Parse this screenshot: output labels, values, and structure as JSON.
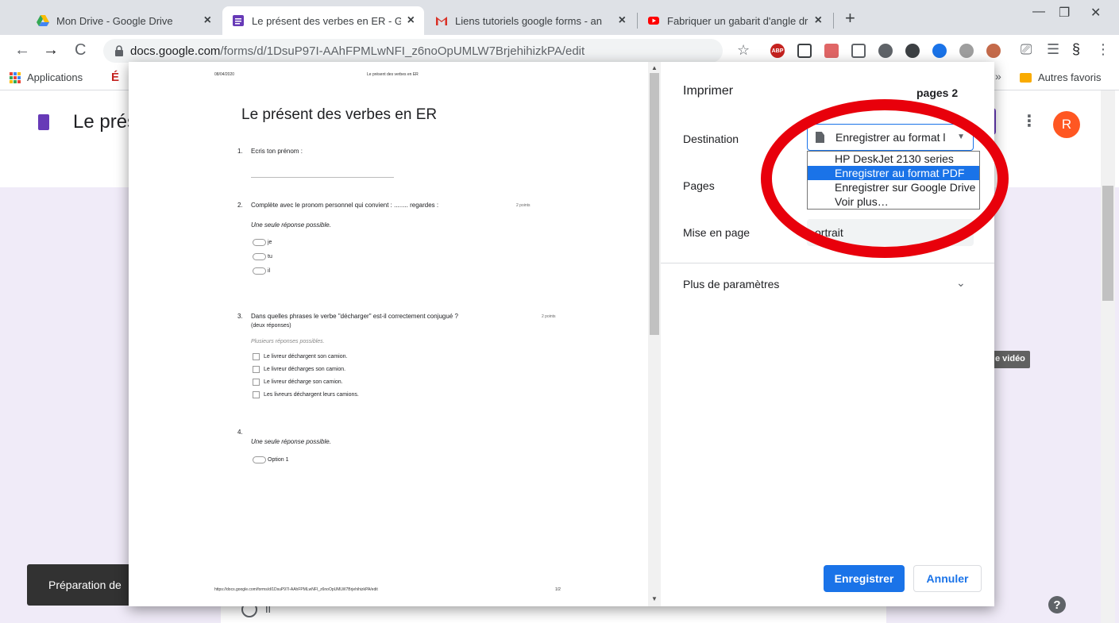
{
  "colors": {
    "accent_blue": "#1a73e8",
    "forms_purple": "#673ab7",
    "annotation_red": "#e8000b",
    "avatar_orange": "#ff5722",
    "toast_bg": "#323232"
  },
  "browser": {
    "tabs": [
      {
        "title": "Mon Drive - Google Drive",
        "icon": "google-drive-icon",
        "close": "×"
      },
      {
        "title": "Le présent des verbes en ER - Go",
        "icon": "google-forms-icon",
        "close": "×"
      },
      {
        "title": "Liens tutoriels google forms - an",
        "icon": "gmail-icon",
        "close": "×"
      },
      {
        "title": "Fabriquer un gabarit d'angle droi",
        "icon": "youtube-icon",
        "close": "×"
      }
    ],
    "new_tab": "+",
    "window_controls": [
      "—",
      "❐",
      "✕"
    ],
    "nav": {
      "back": "←",
      "forward": "→",
      "reload": "C"
    },
    "address": {
      "host": "docs.google.com",
      "path": "/forms/d/1DsuP97I-AAhFPMLwNFI_z6noOpUMLW7BrjehihizkPA/edit"
    },
    "star": "☆",
    "extensions": [
      {
        "icon": "adblock-plus-icon",
        "label": "ABP",
        "color": "#c5221f"
      },
      {
        "icon": "lightbulb-extension-icon",
        "label": "",
        "color": "#3c4043"
      },
      {
        "icon": "acrobat-icon",
        "label": "",
        "color": "#e06666"
      },
      {
        "icon": "pocket-icon",
        "label": "",
        "color": "#5f6368"
      },
      {
        "icon": "shield-extension-icon",
        "label": "",
        "color": "#5f6368"
      },
      {
        "icon": "privacy-badger-icon",
        "label": "",
        "color": "#3c4043"
      },
      {
        "icon": "blue-star-extension-icon",
        "label": "",
        "color": "#1a73e8"
      },
      {
        "icon": "tomato-timer-icon",
        "label": "",
        "color": "#5f6368"
      },
      {
        "icon": "mascot-extension-icon",
        "label": "",
        "color": "#c46a4a"
      }
    ],
    "toolbar_icons": {
      "cast": "⎚",
      "reading_list": "☰",
      "profile": "§",
      "menu": "⋮"
    },
    "bookmarks": {
      "apps": "Applications",
      "e_icon": "É",
      "overflow": "»",
      "other": "Autres favoris"
    }
  },
  "forms_page": {
    "title": "Le prés",
    "avatar_letter": "R",
    "kebab": "⋮",
    "video_chip": "e vidéo",
    "radio_option": "il",
    "help": "?",
    "toast": "Préparation de"
  },
  "print_dialog": {
    "title": "Imprimer",
    "page_count": "pages 2",
    "destination_label": "Destination",
    "destination_value": "Enregistrer au format l",
    "destination_options": [
      {
        "label": "HP DeskJet 2130 series",
        "selected": false
      },
      {
        "label": "Enregistrer au format PDF",
        "selected": true
      },
      {
        "label": "Enregistrer sur Google Drive",
        "selected": false
      },
      {
        "label": "Voir plus…",
        "selected": false
      }
    ],
    "pages_label": "Pages",
    "layout_label": "Mise en page",
    "layout_value": "ortrait",
    "more_settings": "Plus de paramètres",
    "more_chevron": "⌄",
    "save_button": "Enregistrer",
    "cancel_button": "Annuler"
  },
  "preview": {
    "header_date": "08/04/2020",
    "header_title": "Le présent des verbes en ER",
    "doc_title": "Le présent des verbes en ER",
    "q1": {
      "num": "1.",
      "text": "Ecris ton prénom :"
    },
    "q2": {
      "num": "2.",
      "text": "Complète avec le pronom personnel qui convient : ........ regardes :",
      "points": "2 points",
      "hint": "Une seule réponse possible.",
      "options": [
        "je",
        "tu",
        "il"
      ]
    },
    "q3": {
      "num": "3.",
      "text": "Dans quelles phrases le verbe \"décharger\" est-il correctement conjugué ?",
      "points": "2 points",
      "sub": "(deux réponses)",
      "hint": "Plusieurs réponses possibles.",
      "options": [
        "Le livreur déchargent son camion.",
        "Le livreur décharges son camion.",
        "Le livreur décharge son camion.",
        "Les livreurs déchargent leurs camions."
      ]
    },
    "q4": {
      "num": "4.",
      "hint": "Une seule réponse possible.",
      "options": [
        "Option 1"
      ]
    },
    "footer_url": "https://docs.google.com/forms/d/1DsuP97I-AAhFPMLwNFI_z6noOpUMLW7BrjehihizkPA/edit",
    "footer_page": "1/2"
  }
}
